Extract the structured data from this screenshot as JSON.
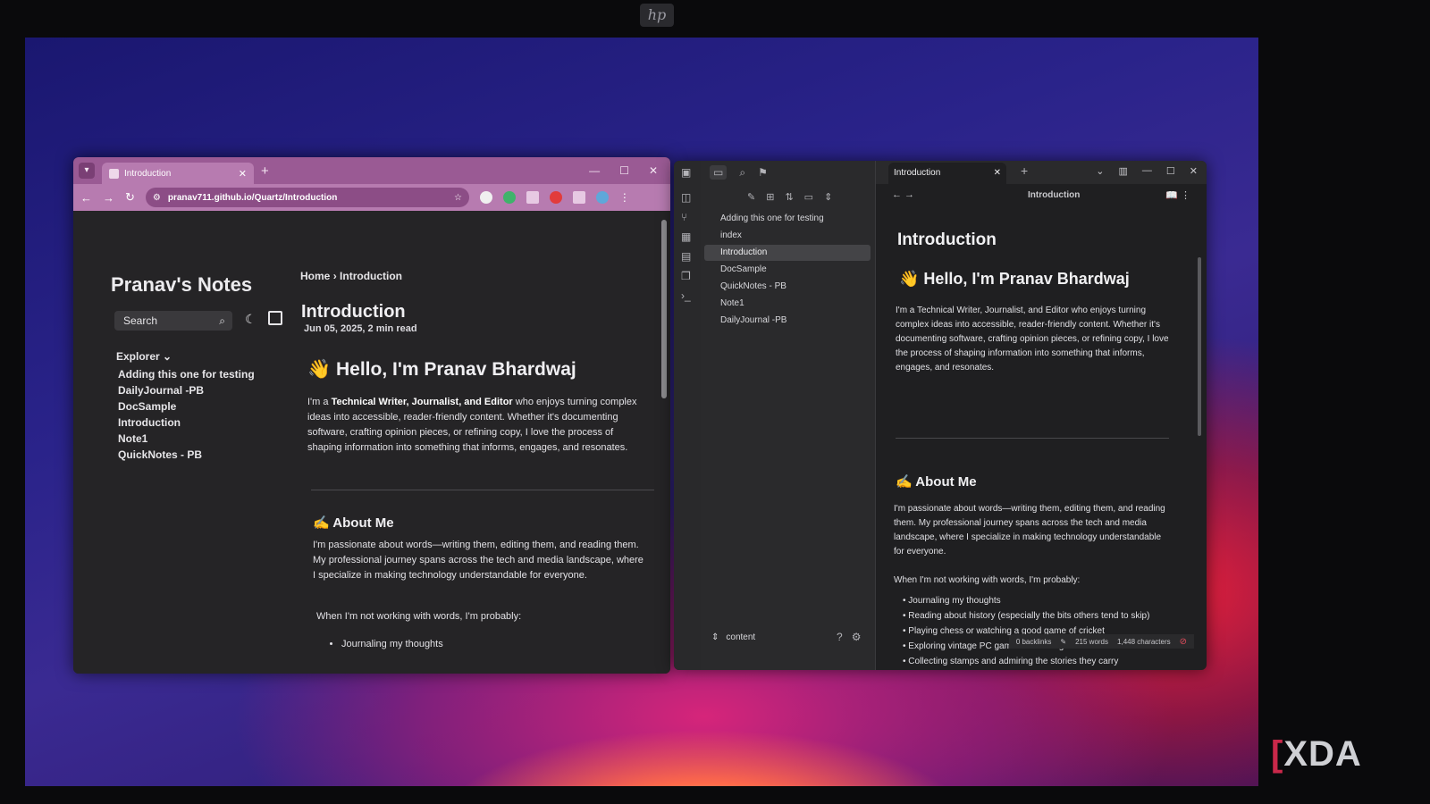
{
  "browser": {
    "tab_title": "Introduction",
    "url": "pranav711.github.io/Quartz/Introduction",
    "site_title": "Pranav's Notes",
    "search_placeholder": "Search",
    "explorer_label": "Explorer",
    "explorer_items": [
      "Adding this one for testing",
      "DailyJournal -PB",
      "DocSample",
      "Introduction",
      "Note1",
      "QuickNotes - PB"
    ],
    "breadcrumb_home": "Home",
    "breadcrumb_current": "Introduction",
    "page_title": "Introduction",
    "page_meta": "Jun 05, 2025, 2 min read",
    "hello_heading": "👋 Hello, I'm Pranav Bhardwaj",
    "intro_lead": "I'm a ",
    "intro_roles": "Technical Writer, Journalist, and Editor",
    "intro_rest": " who enjoys turning complex ideas into accessible, reader-friendly content. Whether it's documenting software, crafting opinion pieces, or refining copy, I love the process of shaping information into something that informs, engages, and resonates.",
    "about_heading": "✍ About Me",
    "about_text": "I'm passionate about words—writing them, editing them, and reading them. My professional journey spans across the tech and media landscape, where I specialize in making technology understandable for everyone.",
    "probably_text": "When I'm not working with words, I'm probably:",
    "list_items": [
      "Journaling my thoughts"
    ]
  },
  "obsidian": {
    "tab_title": "Introduction",
    "view_title": "Introduction",
    "files": [
      "Adding this one for testing",
      "index",
      "Introduction",
      "DocSample",
      "QuickNotes - PB",
      "Note1",
      "DailyJournal -PB"
    ],
    "selected_file": "Introduction",
    "vault_name": "content",
    "note_title": "Introduction",
    "hello_heading": "👋 Hello, I'm Pranav Bhardwaj",
    "intro_text": "I'm a Technical Writer, Journalist, and Editor who enjoys turning complex ideas into accessible, reader-friendly content. Whether it's documenting software, crafting opinion pieces, or refining copy, I love the process of shaping information into something that informs, engages, and resonates.",
    "about_heading": "✍ About Me",
    "about_text": "I'm passionate about words—writing them, editing them, and reading them. My professional journey spans across the tech and media landscape, where I specialize in making technology understandable for everyone.",
    "probably_text": "When I'm not working with words, I'm probably:",
    "list_items": [
      "Journaling my thoughts",
      "Reading about history (especially the bits others tend to skip)",
      "Playing chess or watching a good game of cricket",
      "Exploring vintage PC games from the golden era",
      "Collecting stamps and admiring the stories they carry"
    ],
    "status_backlinks": "0 backlinks",
    "status_words": "215 words",
    "status_chars": "1,448 characters"
  },
  "watermark": "XDA",
  "brand_logo": "hp",
  "colors": {
    "browser_accent": "#b77bb0",
    "obsidian_bg": "#1f1f21",
    "quartz_bg": "#252426"
  }
}
